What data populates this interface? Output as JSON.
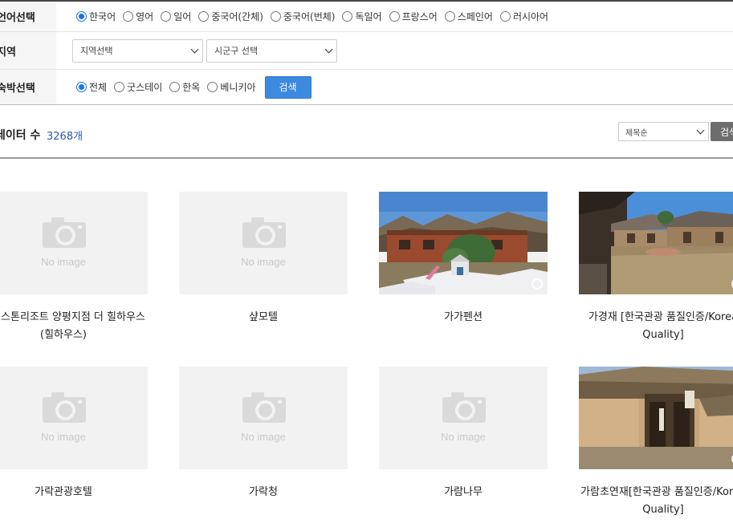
{
  "filters": {
    "language": {
      "label": "언어선택",
      "options": [
        "한국어",
        "영어",
        "일어",
        "중국어(간체)",
        "중국어(번체)",
        "독일어",
        "프랑스어",
        "스페인어",
        "러시아어"
      ],
      "selected": "한국어"
    },
    "region": {
      "label": "지역",
      "region_select": "지역선택",
      "district_select": "시군구 선택"
    },
    "lodging": {
      "label": "숙박선택",
      "options": [
        "전체",
        "굿스테이",
        "한옥",
        "베니키아"
      ],
      "selected": "전체",
      "search_button": "검색"
    }
  },
  "results": {
    "count_label": "데이터 수",
    "count_value": "3268개",
    "sort_select": "제목순",
    "sort_button": "검색"
  },
  "cards": [
    {
      "title": "라랙스톤리조트 양평지점 더 힐하우스(힐하우스)",
      "image": "no-image"
    },
    {
      "title": "샾모텔",
      "image": "no-image"
    },
    {
      "title": "가가펜션",
      "image": "photo-wooden-pension-snow"
    },
    {
      "title": "가경재 [한국관광 품질인증/Korea Quality]",
      "image": "photo-hanok-courtyard"
    },
    {
      "title": "가락관광호텔",
      "image": "no-image"
    },
    {
      "title": "가락청",
      "image": "no-image"
    },
    {
      "title": "가람나무",
      "image": "no-image"
    },
    {
      "title": "가람초연재[한국관광 품질인증/Korea Quality]",
      "image": "photo-thatched-gate"
    }
  ],
  "no_image_text": "No image"
}
